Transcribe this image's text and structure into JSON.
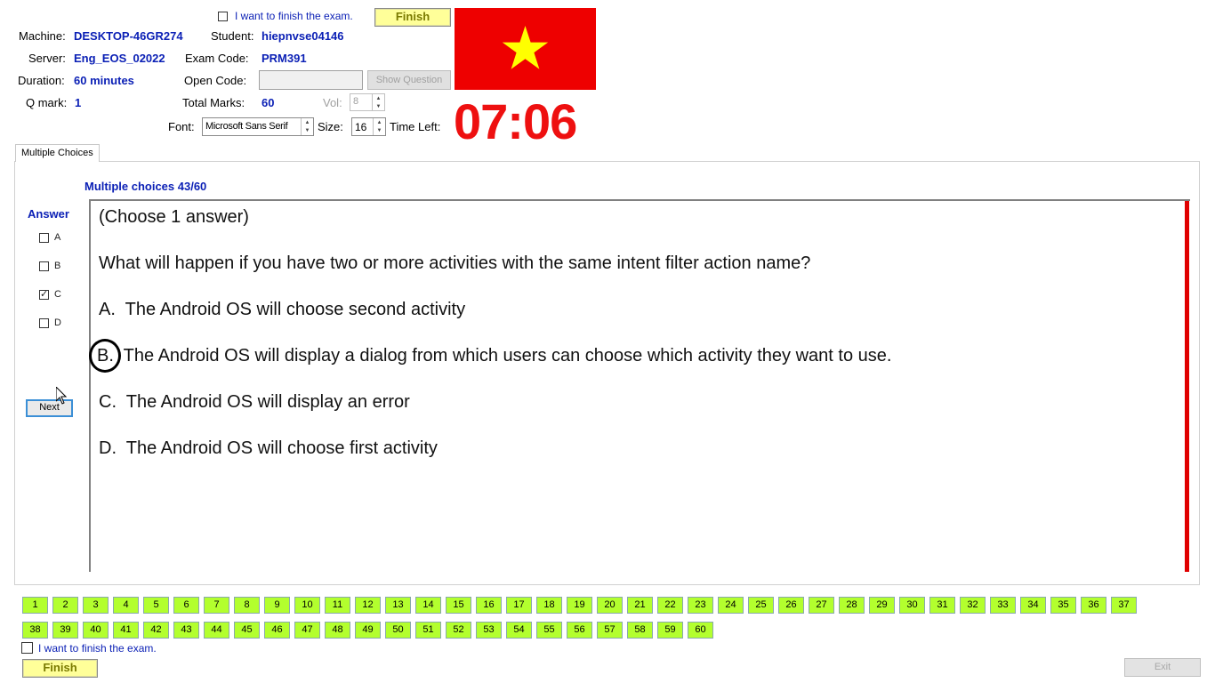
{
  "header": {
    "finish_checkbox_label": "I want to finish the exam.",
    "finish_button": "Finish",
    "machine_label": "Machine:",
    "machine_value": "DESKTOP-46GR274",
    "student_label": "Student:",
    "student_value": "hiepnvse04146",
    "server_label": "Server:",
    "server_value": "Eng_EOS_02022",
    "exam_code_label": "Exam Code:",
    "exam_code_value": "PRM391",
    "duration_label": "Duration:",
    "duration_value": "60 minutes",
    "open_code_label": "Open Code:",
    "open_code_value": "",
    "show_question_button": "Show Question",
    "qmark_label": "Q mark:",
    "qmark_value": "1",
    "total_marks_label": "Total Marks:",
    "total_marks_value": "60",
    "vol_label": "Vol:",
    "vol_value": "8",
    "font_label": "Font:",
    "font_value": "Microsoft Sans Serif",
    "size_label": "Size:",
    "size_value": "16",
    "time_left_label": "Time Left:",
    "time_left_value": "07:06"
  },
  "tabs": [
    {
      "label": "Multiple Choices",
      "active": true
    }
  ],
  "question": {
    "counter": "Multiple choices 43/60",
    "answer_heading": "Answer",
    "answer_options": [
      {
        "label": "A",
        "checked": false
      },
      {
        "label": "B",
        "checked": false
      },
      {
        "label": "C",
        "checked": true
      },
      {
        "label": "D",
        "checked": false
      }
    ],
    "next_button": "Next",
    "instruction": "(Choose 1 answer)",
    "text": "What will happen if you have two or more activities with the same intent filter action name?",
    "choices": [
      {
        "letter": "A.",
        "text": "The Android OS will choose second activity"
      },
      {
        "letter": "B.",
        "text": "The Android OS will display a dialog from which users can choose which activity they want to use."
      },
      {
        "letter": "C.",
        "text": "The Android OS will display an error"
      },
      {
        "letter": "D.",
        "text": "The Android OS will choose first activity"
      }
    ]
  },
  "question_numbers_row1": [
    "1",
    "2",
    "3",
    "4",
    "5",
    "6",
    "7",
    "8",
    "9",
    "10",
    "11",
    "12",
    "13",
    "14",
    "15",
    "16",
    "17",
    "18",
    "19",
    "20",
    "21",
    "22",
    "23",
    "24",
    "25",
    "26",
    "27",
    "28",
    "29",
    "30",
    "31",
    "32",
    "33",
    "34",
    "35",
    "36",
    "37"
  ],
  "question_numbers_row2": [
    "38",
    "39",
    "40",
    "41",
    "42",
    "43",
    "44",
    "45",
    "46",
    "47",
    "48",
    "49",
    "50",
    "51",
    "52",
    "53",
    "54",
    "55",
    "56",
    "57",
    "58",
    "59",
    "60"
  ],
  "footer": {
    "finish_checkbox_label": "I want to finish the exam.",
    "finish_button": "Finish",
    "exit_button": "Exit"
  },
  "colors": {
    "flag_red": "#ee0000",
    "flag_star": "#ffff00",
    "timer": "#ee1010",
    "qnum_green": "#b3ff2e",
    "value_blue": "#0a1fb5"
  }
}
